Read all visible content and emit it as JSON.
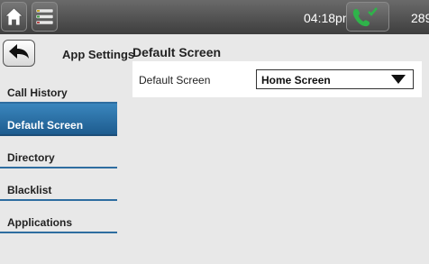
{
  "status": {
    "time": "04:18pm",
    "extension": "289"
  },
  "sidebar": {
    "title": "App Settings",
    "items": [
      {
        "label": "Call History"
      },
      {
        "label": "Default Screen"
      },
      {
        "label": "Directory"
      },
      {
        "label": "Blacklist"
      },
      {
        "label": "Applications"
      }
    ]
  },
  "content": {
    "title": "Default Screen",
    "setting_label": "Default Screen",
    "setting_value": "Home Screen"
  },
  "colors": {
    "active_item": "#2a74a8",
    "call_icon": "#2fb34a"
  },
  "icons": {
    "home": "home-icon",
    "menu": "menu-list-icon",
    "phone": "phone-check-icon",
    "back": "back-arrow-icon"
  }
}
